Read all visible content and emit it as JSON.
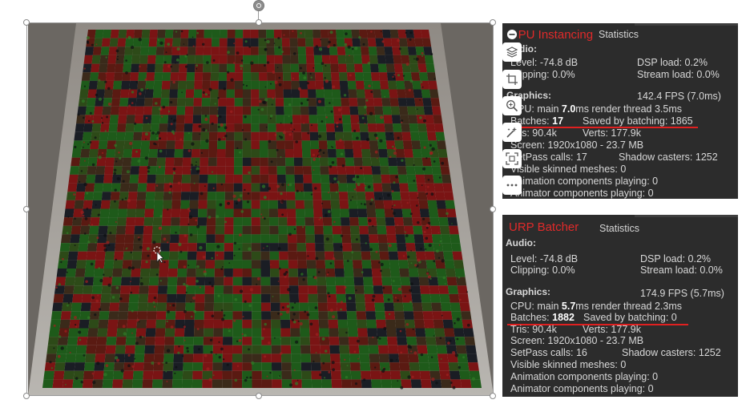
{
  "toolbar": {
    "tools": [
      "minus-circle-icon",
      "layers-icon",
      "crop-icon",
      "zoom-in-icon",
      "magic-wand-icon",
      "screen-select-icon",
      "more-icon"
    ]
  },
  "panel_top": {
    "title": "GPU Instancing",
    "tab": "Statistics",
    "audio_label": "Audio:",
    "level": "Level: -74.8 dB",
    "clipping": "Clipping: 0.0%",
    "dsp_load": "DSP load: 0.2%",
    "stream_load": "Stream load: 0.0%",
    "graphics_label": "Graphics:",
    "fps": "142.4 FPS (7.0ms)",
    "cpu_prefix": "CPU: main ",
    "cpu_main": "7.0",
    "cpu_suffix": "ms  render thread 3.5ms",
    "batches_prefix": "Batches: ",
    "batches": "17",
    "saved": "Saved by batching: 1865",
    "tris": "Tris: 90.4k",
    "verts": "Verts: 177.9k",
    "screen": "Screen: 1920x1080 - 23.7 MB",
    "setpass": "SetPass calls: 17",
    "shadow": "Shadow casters: 1252",
    "skinned": "Visible skinned meshes: 0",
    "animation": "Animation components playing: 0",
    "animator": "Animator components playing: 0"
  },
  "panel_bottom": {
    "title": "URP Batcher",
    "tab": "Statistics",
    "audio_label": "Audio:",
    "level": "Level: -74.8 dB",
    "clipping": "Clipping: 0.0%",
    "dsp_load": "DSP load: 0.2%",
    "stream_load": "Stream load: 0.0%",
    "graphics_label": "Graphics:",
    "fps": "174.9 FPS (5.7ms)",
    "cpu_prefix": "CPU: main ",
    "cpu_main": "5.7",
    "cpu_suffix": "ms  render thread 2.3ms",
    "batches_prefix": "Batches: ",
    "batches": "1882",
    "saved": "Saved by batching: 0",
    "tris": "Tris: 90.4k",
    "verts": "Verts: 177.9k",
    "screen": "Screen: 1920x1080 - 23.7 MB",
    "setpass": "SetPass calls: 16",
    "shadow": "Shadow casters: 1252",
    "skinned": "Visible skinned meshes: 0",
    "animation": "Animation components playing: 0",
    "animator": "Animator components playing: 0"
  },
  "colors": {
    "accent_red": "#e02a2a",
    "panel_bg": "#2c2c2c",
    "tile_red": "#7a1414",
    "tile_green": "#1e5a1a",
    "tile_dark": "#1a1d24"
  }
}
